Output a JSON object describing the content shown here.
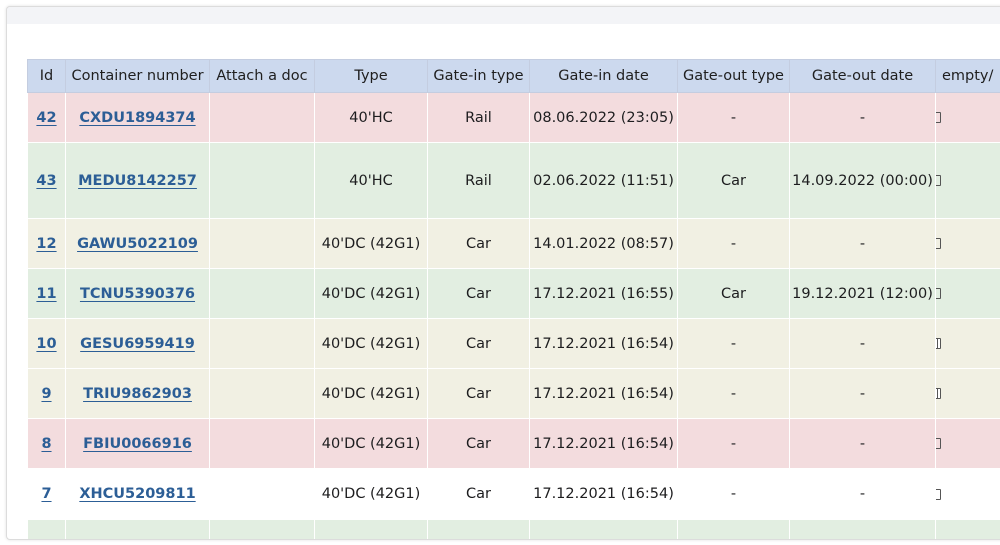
{
  "table": {
    "columns": [
      "Id",
      "Container number",
      "Attach a doc",
      "Type",
      "Gate-in type",
      "Gate-in date",
      "Gate-out type",
      "Gate-out date",
      "empty/"
    ],
    "rows": [
      {
        "id": "42",
        "container": "CXDU1894374",
        "attach": "",
        "type": "40'HC",
        "gate_in_type": "Rail",
        "gate_in_date": "08.06.2022 (23:05)",
        "gate_out_type": "-",
        "gate_out_date": "-",
        "icon": "document-icon"
      },
      {
        "id": "43",
        "container": "MEDU8142257",
        "attach": "",
        "type": "40'HC",
        "gate_in_type": "Rail",
        "gate_in_date": "02.06.2022 (11:51)",
        "gate_out_type": "Car",
        "gate_out_date": "14.09.2022 (00:00)",
        "icon": "document-icon"
      },
      {
        "id": "12",
        "container": "GAWU5022109",
        "attach": "",
        "type": "40'DC (42G1)",
        "gate_in_type": "Car",
        "gate_in_date": "14.01.2022 (08:57)",
        "gate_out_type": "-",
        "gate_out_date": "-",
        "icon": "document-icon"
      },
      {
        "id": "11",
        "container": "TCNU5390376",
        "attach": "",
        "type": "40'DC (42G1)",
        "gate_in_type": "Car",
        "gate_in_date": "17.12.2021 (16:55)",
        "gate_out_type": "Car",
        "gate_out_date": "19.12.2021 (12:00)",
        "icon": "document-icon"
      },
      {
        "id": "10",
        "container": "GESU6959419",
        "attach": "",
        "type": "40'DC (42G1)",
        "gate_in_type": "Car",
        "gate_in_date": "17.12.2021 (16:54)",
        "gate_out_type": "-",
        "gate_out_date": "-",
        "icon": "full-container-icon"
      },
      {
        "id": "9",
        "container": "TRIU9862903",
        "attach": "",
        "type": "40'DC (42G1)",
        "gate_in_type": "Car",
        "gate_in_date": "17.12.2021 (16:54)",
        "gate_out_type": "-",
        "gate_out_date": "-",
        "icon": "full-container-icon"
      },
      {
        "id": "8",
        "container": "FBIU0066916",
        "attach": "",
        "type": "40'DC (42G1)",
        "gate_in_type": "Car",
        "gate_in_date": "17.12.2021 (16:54)",
        "gate_out_type": "-",
        "gate_out_date": "-",
        "icon": "document-icon"
      },
      {
        "id": "7",
        "container": "XHCU5209811",
        "attach": "",
        "type": "40'DC (42G1)",
        "gate_in_type": "Car",
        "gate_in_date": "17.12.2021 (16:54)",
        "gate_out_type": "-",
        "gate_out_date": "-",
        "icon": "document-icon"
      }
    ],
    "row_colors": {
      "red": "#f3dcde",
      "green": "#e2eee1",
      "cream": "#f1f0e3",
      "white": "#ffffff"
    },
    "header_color": "#ccd9ee",
    "link_color": "#2c5e96"
  }
}
